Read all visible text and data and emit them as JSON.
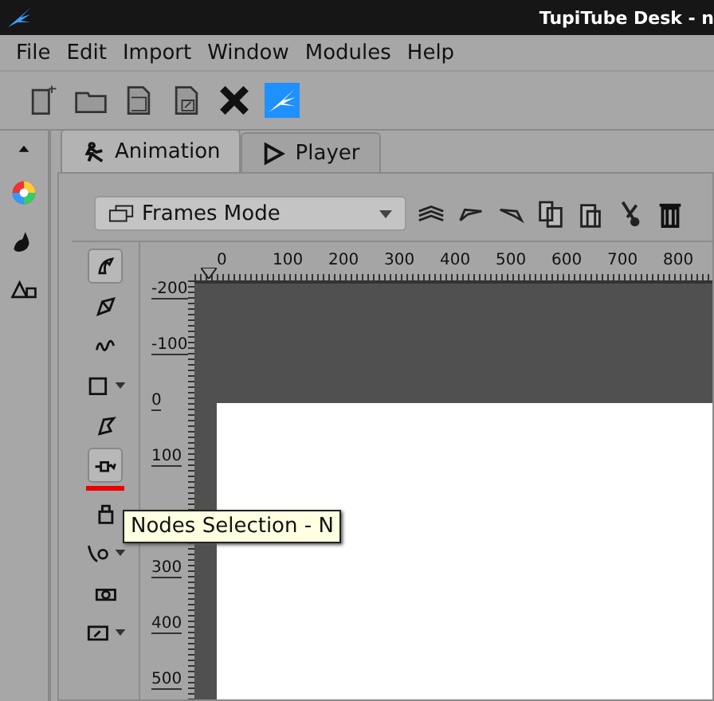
{
  "window": {
    "title": "TupiTube Desk - n"
  },
  "menu": [
    "File",
    "Edit",
    "Import",
    "Window",
    "Modules",
    "Help"
  ],
  "tabs": [
    {
      "label": "Animation",
      "selected": true
    },
    {
      "label": "Player",
      "selected": false
    }
  ],
  "mode_dropdown": {
    "value": "Frames Mode"
  },
  "tools": [
    {
      "selected": true,
      "active": false,
      "dropdown": false
    },
    {
      "selected": false,
      "active": false,
      "dropdown": false
    },
    {
      "selected": false,
      "active": false,
      "dropdown": false
    },
    {
      "selected": false,
      "active": false,
      "dropdown": true
    },
    {
      "selected": false,
      "active": false,
      "dropdown": false
    },
    {
      "selected": true,
      "active": true,
      "dropdown": false
    },
    {
      "selected": false,
      "active": false,
      "dropdown": false
    },
    {
      "selected": false,
      "active": false,
      "dropdown": true
    },
    {
      "selected": false,
      "active": false,
      "dropdown": false
    },
    {
      "selected": false,
      "active": false,
      "dropdown": true
    }
  ],
  "top_ruler": [
    "0",
    "100",
    "200",
    "300",
    "400",
    "500",
    "600",
    "700",
    "800"
  ],
  "left_ruler": [
    "-200",
    "-100",
    "0",
    "100",
    "300",
    "400",
    "500"
  ],
  "tooltip": "Nodes Selection - N"
}
